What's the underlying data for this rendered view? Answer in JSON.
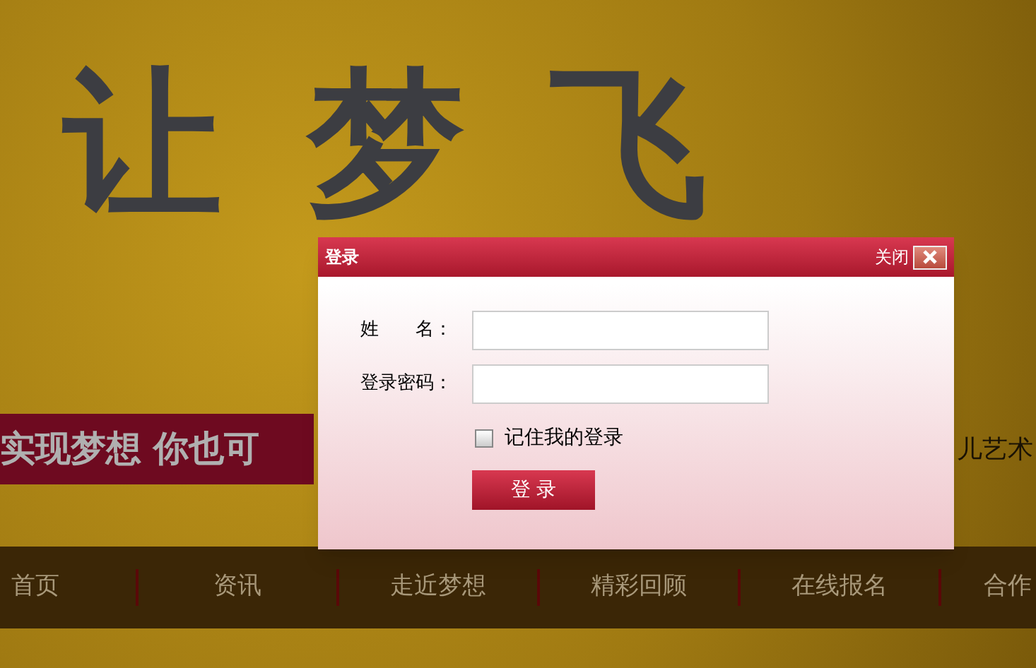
{
  "banner": {
    "headline": [
      "让",
      "梦",
      "飞"
    ],
    "slogan": "实现梦想 你也可",
    "side_text": "儿艺术"
  },
  "nav": [
    {
      "label": "首页"
    },
    {
      "label": "资讯"
    },
    {
      "label": "走近梦想"
    },
    {
      "label": "精彩回顾"
    },
    {
      "label": "在线报名"
    },
    {
      "label": "合作"
    }
  ],
  "dialog": {
    "title": "登录",
    "close_label": "关闭",
    "fields": [
      {
        "label": "姓　　名："
      },
      {
        "label": "登录密码："
      }
    ],
    "remember": {
      "label": "记住我的登录",
      "checked": false
    },
    "submit": "登 录"
  }
}
